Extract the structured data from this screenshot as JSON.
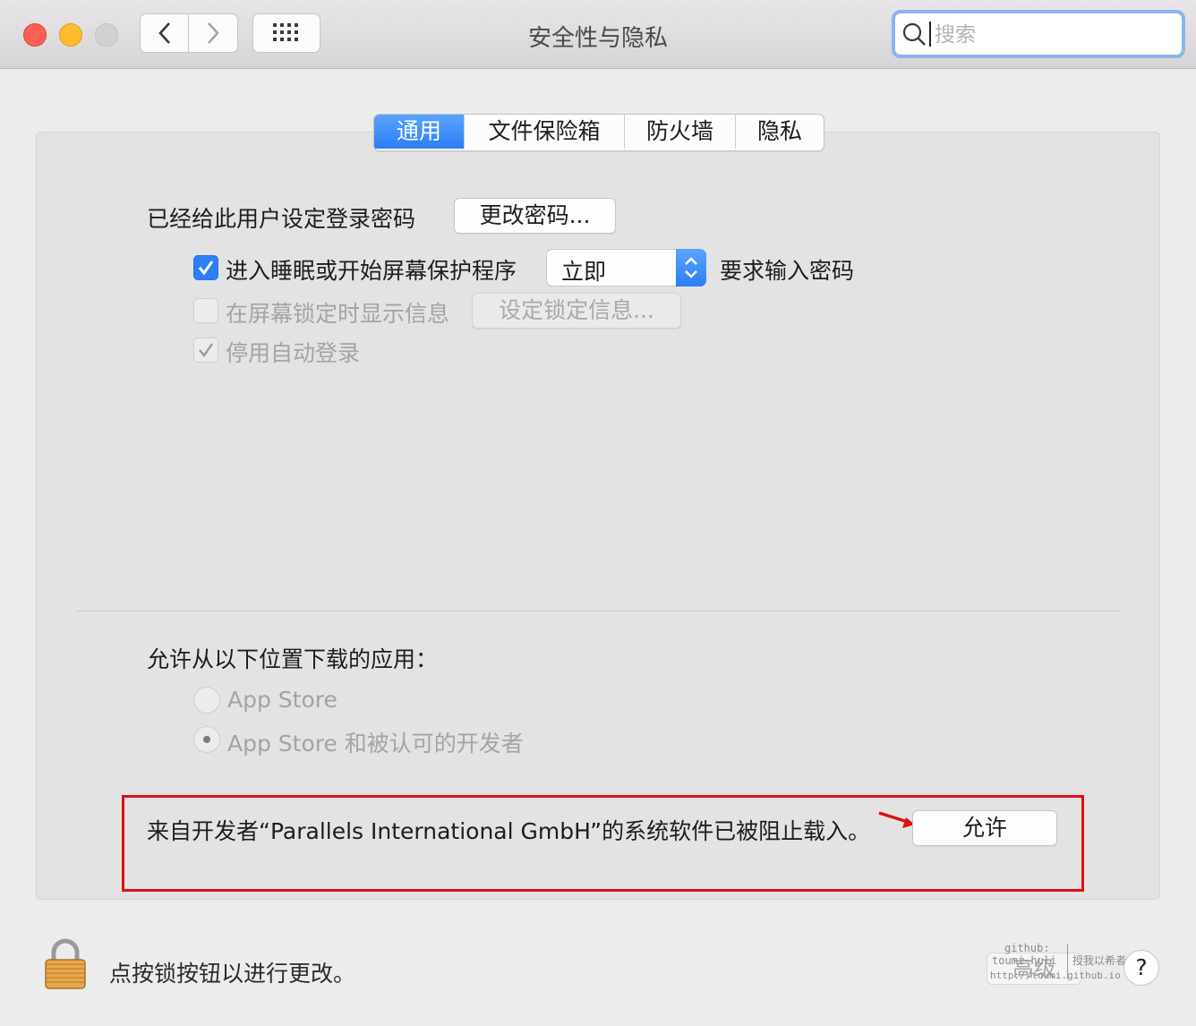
{
  "window": {
    "title": "安全性与隐私"
  },
  "search": {
    "placeholder": "搜索"
  },
  "tabs": [
    {
      "label": "通用",
      "active": true
    },
    {
      "label": "文件保险箱",
      "active": false
    },
    {
      "label": "防火墙",
      "active": false
    },
    {
      "label": "隐私",
      "active": false
    }
  ],
  "general": {
    "password_label": "已经给此用户设定登录密码",
    "change_password_button": "更改密码...",
    "require_password": {
      "checked": true,
      "label_before": "进入睡眠或开始屏幕保护程序",
      "select_value": "立即",
      "label_after": "要求输入密码"
    },
    "show_message": {
      "checked": false,
      "label": "在屏幕锁定时显示信息",
      "button": "设定锁定信息..."
    },
    "disable_autologin": {
      "checked": true,
      "label": "停用自动登录"
    }
  },
  "downloads": {
    "heading": "允许从以下位置下载的应用：",
    "options": [
      {
        "label": "App Store",
        "selected": false
      },
      {
        "label": "App Store 和被认可的开发者",
        "selected": true
      }
    ]
  },
  "blocked": {
    "message": "来自开发者“Parallels International GmbH”的系统软件已被阻止载入。",
    "allow_button": "允许"
  },
  "footer": {
    "lock_text": "点按锁按钮以进行更改。",
    "advanced_button": "高级",
    "help_button": "?"
  },
  "watermark": {
    "line1": "github:",
    "line2": "toumi~huli",
    "line3": "http://toumi.github.io",
    "handwriting": "授我以希者"
  },
  "colors": {
    "accent": "#2e7ff6",
    "highlight_box": "#e01010",
    "arrow": "#e01010"
  }
}
